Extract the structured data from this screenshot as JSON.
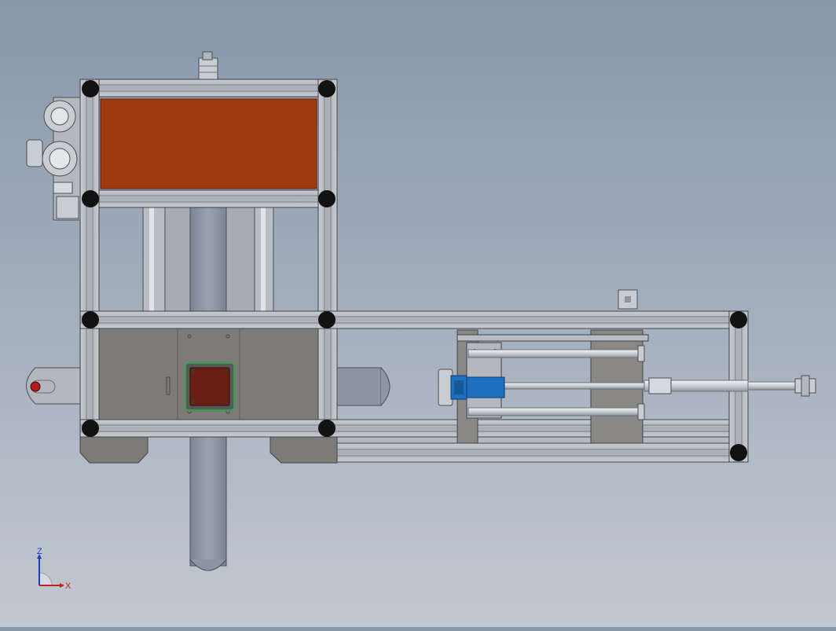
{
  "viewport": {
    "background_top": "#8897ab",
    "background_bottom": "#c2c8d1"
  },
  "colors": {
    "frame_profile": "#b3b8bf",
    "frame_edge": "#40444a",
    "corner_connector": "#111111",
    "heater_panel": "#a1390f",
    "door_panel": "#7d7b78",
    "inspection_window": "#6a1f14",
    "window_seal": "#2fa44a",
    "column": "#8c95a3",
    "slide_block": "#1f6fc0",
    "guide_rod": "#d6dade",
    "indicator_knob": "#b31b1b"
  },
  "triad": {
    "z_label": "Z",
    "x_label": "X",
    "z_color": "#1f3cc7",
    "x_color": "#c41e1e"
  }
}
